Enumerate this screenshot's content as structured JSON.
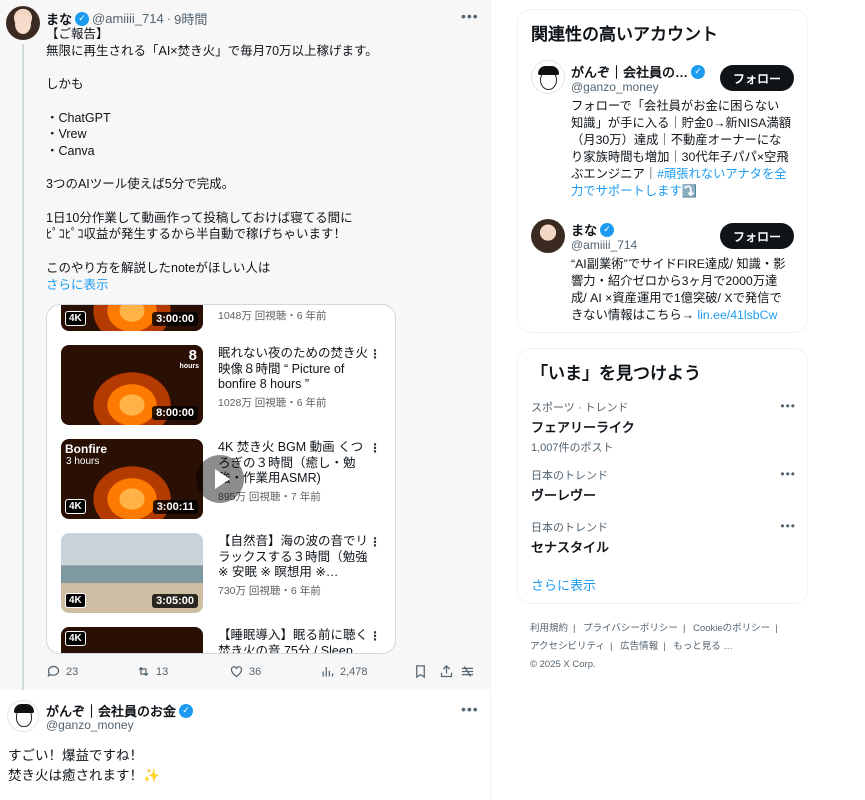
{
  "tweet1": {
    "name": "まな",
    "handle": "@amiiii_714",
    "dot": "·",
    "time": "9時間",
    "lines": [
      "【ご報告】",
      "無限に再生される「AI×焚き火」で毎月70万以上稼げます。",
      "",
      "しかも",
      "",
      "・ChatGPT",
      "・Vrew",
      "・Canva",
      "",
      "3つのAIツール使えば5分で完成。",
      "",
      "1日10分作業して動画作って投稿しておけば寝てる間に",
      "ﾋﾟｺﾋﾟｺ収益が発生するから半自動で稼げちゃいます！",
      "",
      "このやり方を解説したnoteがほしい人は"
    ],
    "show_more": "さらに表示",
    "videos": [
      {
        "title": "",
        "meta": "1048万 回視聴・6 年前",
        "duration": "3:00:00",
        "badge": "4K"
      },
      {
        "title": "眠れない夜のための焚き火映像８時間 “ Picture of bonfire 8 hours ”",
        "meta": "1028万 回視聴・6 年前",
        "duration": "8:00:00",
        "overlay": "8",
        "overlay_sub": "hours"
      },
      {
        "title": "4K 焚き火 BGM 動画 くつろぎの３時間（癒し・勉強・作業用ASMR)",
        "meta": "895万 回視聴・7 年前",
        "duration": "3:00:11",
        "badge": "4K",
        "overlay": "Bonfire",
        "overlay_sub": "3 hours"
      },
      {
        "title": "【自然音】海の波の音でリラックスする３時間（勉強 ※ 安眠 ※ 瞑想用 ※…",
        "meta": "730万 回視聴・6 年前",
        "duration": "3:05:00",
        "badge": "4K"
      },
      {
        "title": "【睡眠導入】眠る前に聴く焚き火の音 75分 / Sleep",
        "meta": "",
        "duration": "",
        "badge": "4K"
      }
    ],
    "actions": {
      "replies": "23",
      "retweets": "13",
      "likes": "36",
      "views": "2,478"
    }
  },
  "tweet2": {
    "name": "がんぞ｜会社員のお金",
    "handle": "@ganzo_money",
    "lines": [
      "すごい！爆益ですね！",
      "焚き火は癒されます！✨"
    ]
  },
  "related": {
    "title": "関連性の高いアカウント",
    "accounts": [
      {
        "name": "がんぞ｜会社員の…",
        "handle": "@ganzo_money",
        "follow": "フォロー",
        "bio_lines": [
          "フォローで「会社員がお金に困らない",
          "知識」が手に入る｜貯金0→新NISA満額",
          "（月30万）達成｜不動産オーナーにな",
          "り家族時間も増加｜30代年子パパ×空飛",
          "ぶエンジニア｜"
        ],
        "bio_link": "#頑張れないアナタを全",
        "bio_link2": "力でサポートします",
        "bio_tail": "⤵️"
      },
      {
        "name": "まな",
        "handle": "@amiiii_714",
        "follow": "フォロー",
        "bio_lines": [
          "“AI副業術”でサイドFIRE達成/ 知識・影",
          "響力・紹介ゼロから3ヶ月で2000万達",
          "成/ AI ×資産運用で1億突破/ Xで発信で",
          "きない情報はこちら→ "
        ],
        "bio_link": "lin.ee/41lsbCw"
      }
    ]
  },
  "trends": {
    "title": "「いま」を見つけよう",
    "items": [
      {
        "category": "スポーツ · トレンド",
        "name": "フェアリーライク",
        "count": "1,007件のポスト"
      },
      {
        "category": "日本のトレンド",
        "name": "ヴーレヴー",
        "count": ""
      },
      {
        "category": "日本のトレンド",
        "name": "セナスタイル",
        "count": ""
      }
    ],
    "show_more": "さらに表示"
  },
  "footer": {
    "links": [
      "利用規約",
      "プライバシーポリシー",
      "Cookieのポリシー",
      "アクセシビリティ",
      "広告情報",
      "もっと見る …"
    ],
    "copyright": "© 2025 X Corp."
  },
  "colors": {
    "accent": "#1d9bf0",
    "text": "#0f1419",
    "muted": "#536471"
  }
}
